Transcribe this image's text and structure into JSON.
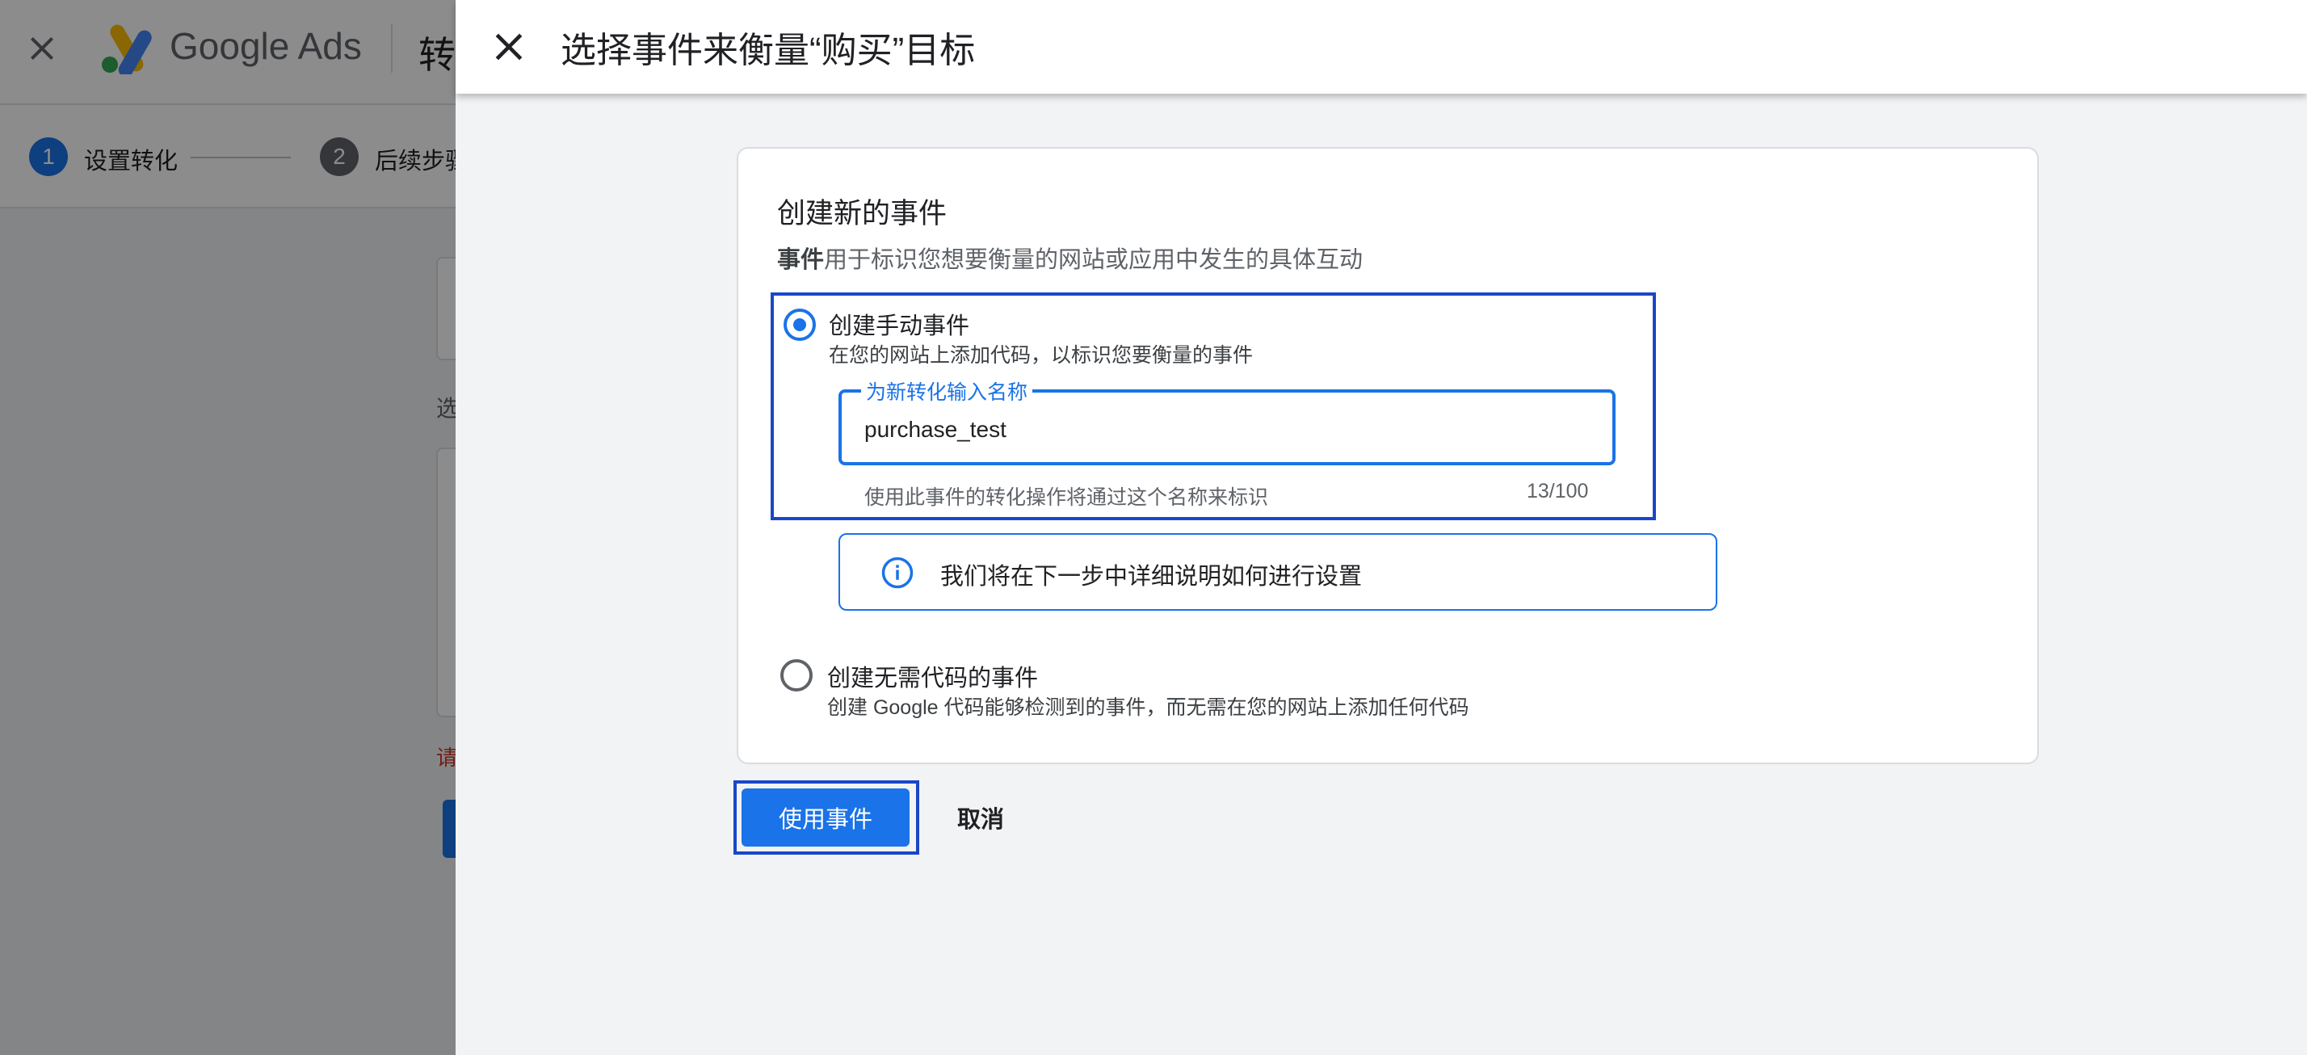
{
  "background": {
    "brand": "Google Ads",
    "title_fragment": "转",
    "steps": [
      {
        "number": "1",
        "label": "设置转化",
        "color": "#1a73e8"
      },
      {
        "number": "2",
        "label": "后续步骤",
        "color": "#5f6368"
      }
    ],
    "select_fragment": "选",
    "required_fragment": "请"
  },
  "dialog": {
    "title": "选择事件来衡量“购买”目标",
    "card": {
      "heading": "创建新的事件",
      "description_bold": "事件",
      "description_rest": "用于标识您想要衡量的网站或应用中发生的具体互动",
      "option_manual": {
        "label": "创建手动事件",
        "sublabel": "在您的网站上添加代码，以标识您要衡量的事件",
        "selected": true,
        "field_label": "为新转化输入名称",
        "field_value": "purchase_test",
        "helper": "使用此事件的转化操作将通过这个名称来标识",
        "counter": "13/100"
      },
      "info_message": "我们将在下一步中详细说明如何进行设置",
      "option_codeless": {
        "label": "创建无需代码的事件",
        "sublabel": "创建 Google 代码能够检测到的事件，而无需在您的网站上添加任何代码",
        "selected": false
      }
    },
    "primary_button": "使用事件",
    "cancel_button": "取消"
  },
  "colors": {
    "accent": "#1a73e8",
    "highlight": "#1a47c8"
  }
}
